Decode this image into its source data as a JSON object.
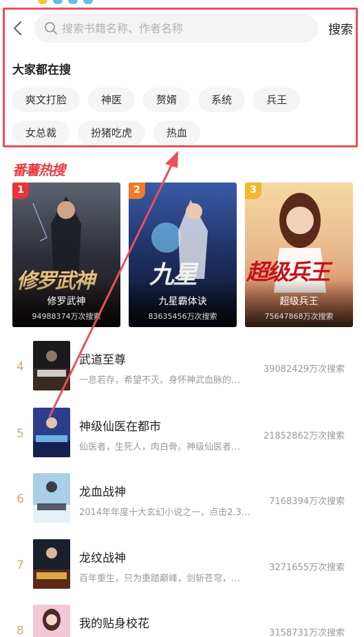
{
  "search": {
    "placeholder": "搜索书籍名称、作者名称",
    "button_label": "搜索"
  },
  "popular": {
    "title": "大家都在搜",
    "tags": [
      "爽文打脸",
      "神医",
      "赘婿",
      "系统",
      "兵王",
      "女总裁",
      "扮猪吃虎",
      "热血"
    ]
  },
  "hot_search": {
    "title": "番薯热搜",
    "top3": [
      {
        "rank": "1",
        "art_title": "修罗武神",
        "name": "修罗武神",
        "count": "94988374万次搜索",
        "badge_color": "#e8343b"
      },
      {
        "rank": "2",
        "art_title": "九星",
        "name": "九星霸体诀",
        "count": "83635456万次搜索",
        "badge_color": "#f27a2a"
      },
      {
        "rank": "3",
        "art_title": "超级兵王",
        "name": "超级兵王",
        "count": "75647868万次搜索",
        "badge_color": "#f3b72e"
      }
    ],
    "list": [
      {
        "rank": "4",
        "title": "武道至尊",
        "desc": "一息若存，希望不灭。身怀神武血脉的…",
        "count": "39082429万次搜索"
      },
      {
        "rank": "5",
        "title": "神级仙医在都市",
        "desc": "仙医者，生死人，肉白骨。神级仙医者…",
        "count": "21852862万次搜索"
      },
      {
        "rank": "6",
        "title": "龙血战神",
        "desc": "2014年年度十大玄幻小说之一，点击2.3…",
        "count": "7168394万次搜索"
      },
      {
        "rank": "7",
        "title": "龙纹战神",
        "desc": "百年重生，只为重踏巅峰，剑斩苍穹，…",
        "count": "3271655万次搜索"
      },
      {
        "rank": "8",
        "title": "我的贴身校花",
        "desc": "",
        "count": "3158731万次搜索"
      }
    ]
  },
  "colors": {
    "accent_red": "#e63c42",
    "highlight_border": "#e8505b",
    "rank_gold": "#c8a97e"
  },
  "icons": {
    "back": "chevron-left-icon",
    "search": "magnifier-icon"
  }
}
